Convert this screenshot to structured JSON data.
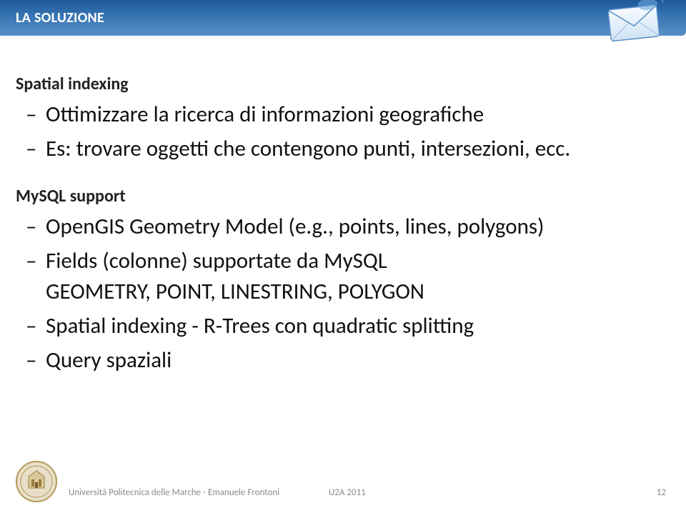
{
  "header": {
    "title": "LA SOLUZIONE"
  },
  "section1": {
    "title": "Spatial indexing",
    "b1": "Ottimizzare la ricerca di informazioni geografiche",
    "b2": "Es: trovare oggetti che contengono punti, intersezioni, ecc."
  },
  "section2": {
    "title": "MySQL support",
    "b1": "OpenGIS Geometry Model (e.g., points, lines, polygons)",
    "b2": "Fields (colonne) supportate da MySQL",
    "b2sub": "GEOMETRY, POINT, LINESTRING, POLYGON",
    "b3": "Spatial indexing - R-Trees con quadratic splitting",
    "b4": "Query spaziali"
  },
  "footer": {
    "left": "Università Politecnica delle Marche - Emanuele Frontoni",
    "center": "U2A 2011",
    "pagenum": "12"
  }
}
